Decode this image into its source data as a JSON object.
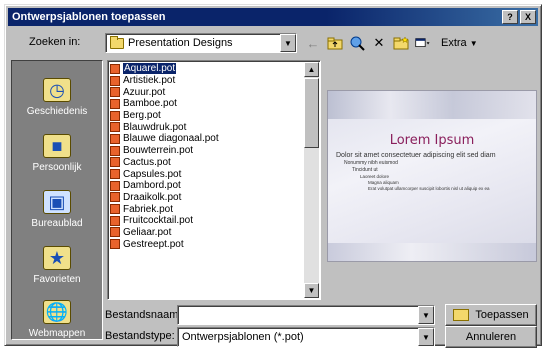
{
  "window": {
    "title": "Ontwerpsjablonen toepassen",
    "help_label": "?",
    "close_label": "X"
  },
  "lookin": {
    "label": "Zoeken in:",
    "value": "Presentation Designs"
  },
  "toolbar": {
    "extra_label": "Extra"
  },
  "places": [
    {
      "label": "Geschiedenis",
      "icon": "history-icon"
    },
    {
      "label": "Persoonlijk",
      "icon": "my-documents-icon"
    },
    {
      "label": "Bureaublad",
      "icon": "desktop-icon"
    },
    {
      "label": "Favorieten",
      "icon": "favorites-icon"
    },
    {
      "label": "Webmappen",
      "icon": "web-folders-icon"
    }
  ],
  "files": [
    "Aquarel.pot",
    "Artistiek.pot",
    "Azuur.pot",
    "Bamboe.pot",
    "Berg.pot",
    "Blauwdruk.pot",
    "Blauwe diagonaal.pot",
    "Bouwterrein.pot",
    "Cactus.pot",
    "Capsules.pot",
    "Dambord.pot",
    "Draaikolk.pot",
    "Fabriek.pot",
    "Fruitcocktail.pot",
    "Geliaar.pot",
    "Gestreept.pot"
  ],
  "selected_file_index": 0,
  "preview": {
    "title": "Lorem Ipsum",
    "bullets": [
      {
        "level": 1,
        "text": "Dolor sit amet consectetuer adipiscing elit sed diam"
      },
      {
        "level": 2,
        "text": "Nonummy nibh euismod"
      },
      {
        "level": 3,
        "text": "Tincidunt ut"
      },
      {
        "level": 4,
        "text": "Laoreet dolore"
      },
      {
        "level": 5,
        "text": "Magna aliquam"
      },
      {
        "level": 5,
        "text": "Erat volutpat ullamcorper suscipit lobortis nisl ut aliquip ex ea"
      }
    ]
  },
  "filename": {
    "label": "Bestandsnaam:",
    "value": ""
  },
  "filetype": {
    "label": "Bestandstype:",
    "value": "Ontwerpsjablonen (*.pot)"
  },
  "buttons": {
    "apply": "Toepassen",
    "cancel": "Annuleren"
  }
}
